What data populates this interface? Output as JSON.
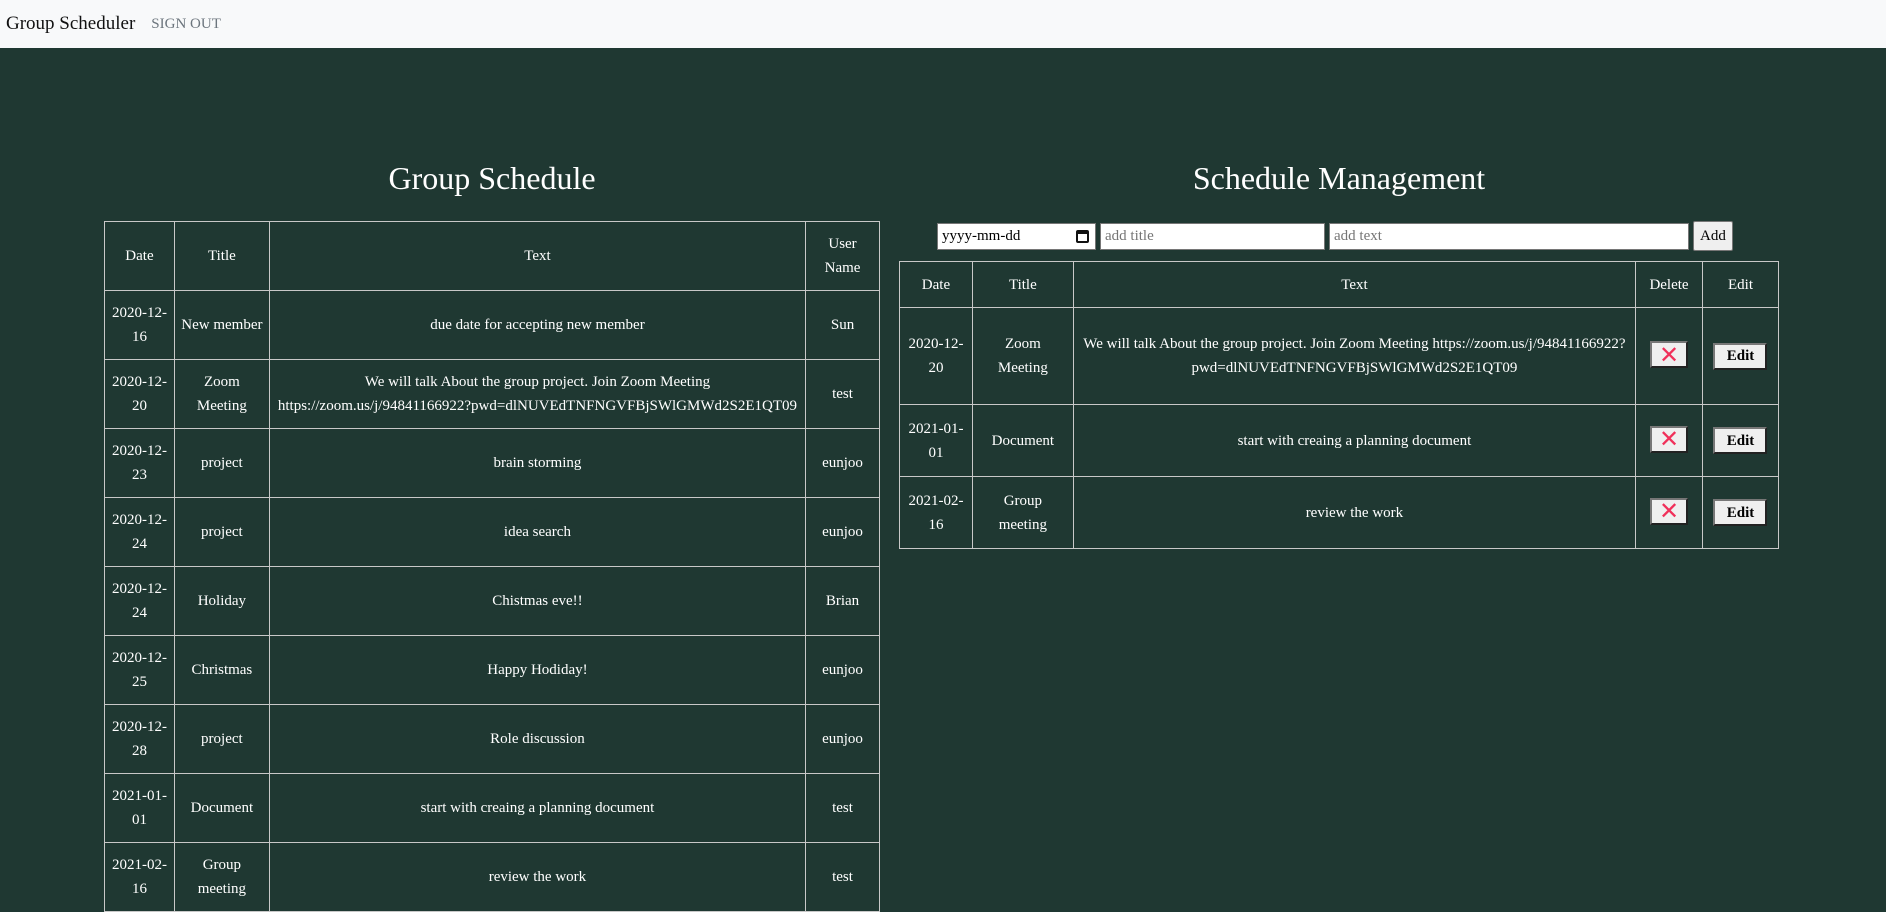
{
  "nav": {
    "brand": "Group Scheduler",
    "signout": "SIGN OUT"
  },
  "left": {
    "title": "Group Schedule",
    "columns": [
      "Date",
      "Title",
      "Text",
      "User Name"
    ],
    "rows": [
      {
        "date": "2020-12-16",
        "title": "New member",
        "text": "due date for accepting new member",
        "user": "Sun"
      },
      {
        "date": "2020-12-20",
        "title": "Zoom Meeting",
        "text": "We will talk About the group project. Join Zoom Meeting https://zoom.us/j/94841166922?pwd=dlNUVEdTNFNGVFBjSWlGMWd2S2E1QT09",
        "user": "test"
      },
      {
        "date": "2020-12-23",
        "title": "project",
        "text": "brain storming",
        "user": "eunjoo"
      },
      {
        "date": "2020-12-24",
        "title": "project",
        "text": "idea search",
        "user": "eunjoo"
      },
      {
        "date": "2020-12-24",
        "title": "Holiday",
        "text": "Chistmas eve!!",
        "user": "Brian"
      },
      {
        "date": "2020-12-25",
        "title": "Christmas",
        "text": "Happy Hodiday!",
        "user": "eunjoo"
      },
      {
        "date": "2020-12-28",
        "title": "project",
        "text": "Role discussion",
        "user": "eunjoo"
      },
      {
        "date": "2021-01-01",
        "title": "Document",
        "text": "start with creaing a planning document",
        "user": "test"
      },
      {
        "date": "2021-02-16",
        "title": "Group meeting",
        "text": "review the work",
        "user": "test"
      }
    ]
  },
  "right": {
    "title": "Schedule Management",
    "form": {
      "date_placeholder": "yyyy-mm-dd",
      "title_placeholder": "add title",
      "text_placeholder": "add text",
      "add_label": "Add"
    },
    "columns": [
      "Date",
      "Title",
      "Text",
      "Delete",
      "Edit"
    ],
    "delete_glyph": "✕",
    "edit_label": "Edit",
    "rows": [
      {
        "date": "2020-12-20",
        "title": "Zoom Meeting",
        "text": "We will talk About the group project. Join Zoom Meeting https://zoom.us/j/94841166922?pwd=dlNUVEdTNFNGVFBjSWlGMWd2S2E1QT09"
      },
      {
        "date": "2021-01-01",
        "title": "Document",
        "text": "start with creaing a planning document"
      },
      {
        "date": "2021-02-16",
        "title": "Group meeting",
        "text": "review the work"
      }
    ]
  }
}
